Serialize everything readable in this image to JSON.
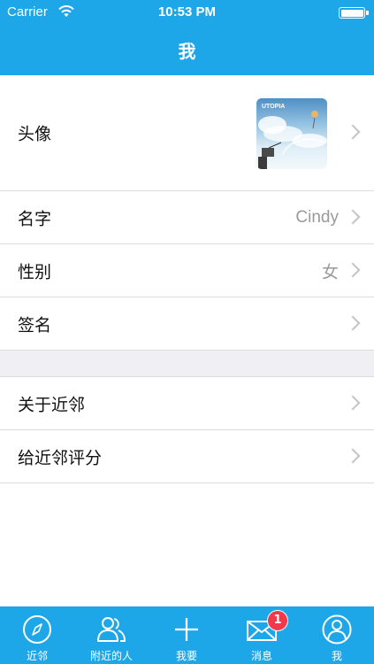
{
  "status_bar": {
    "carrier": "Carrier",
    "time": "10:53 PM"
  },
  "nav": {
    "title": "我"
  },
  "profile": {
    "avatar_label": "头像",
    "avatar_brand_text": "UTOPIA",
    "name_label": "名字",
    "name_value": "Cindy",
    "gender_label": "性别",
    "gender_value": "女",
    "signature_label": "签名"
  },
  "about": {
    "about_label": "关于近邻",
    "rate_label": "给近邻评分"
  },
  "tabbar": {
    "items": [
      {
        "label": "近邻",
        "icon": "compass-icon"
      },
      {
        "label": "附近的人",
        "icon": "people-icon"
      },
      {
        "label": "我要",
        "icon": "plus-icon"
      },
      {
        "label": "消息",
        "icon": "mail-icon",
        "badge": "1"
      },
      {
        "label": "我",
        "icon": "person-icon"
      }
    ]
  },
  "colors": {
    "accent": "#1ea7e8",
    "badge": "#f0394b",
    "separator_bg": "#efeff4"
  }
}
